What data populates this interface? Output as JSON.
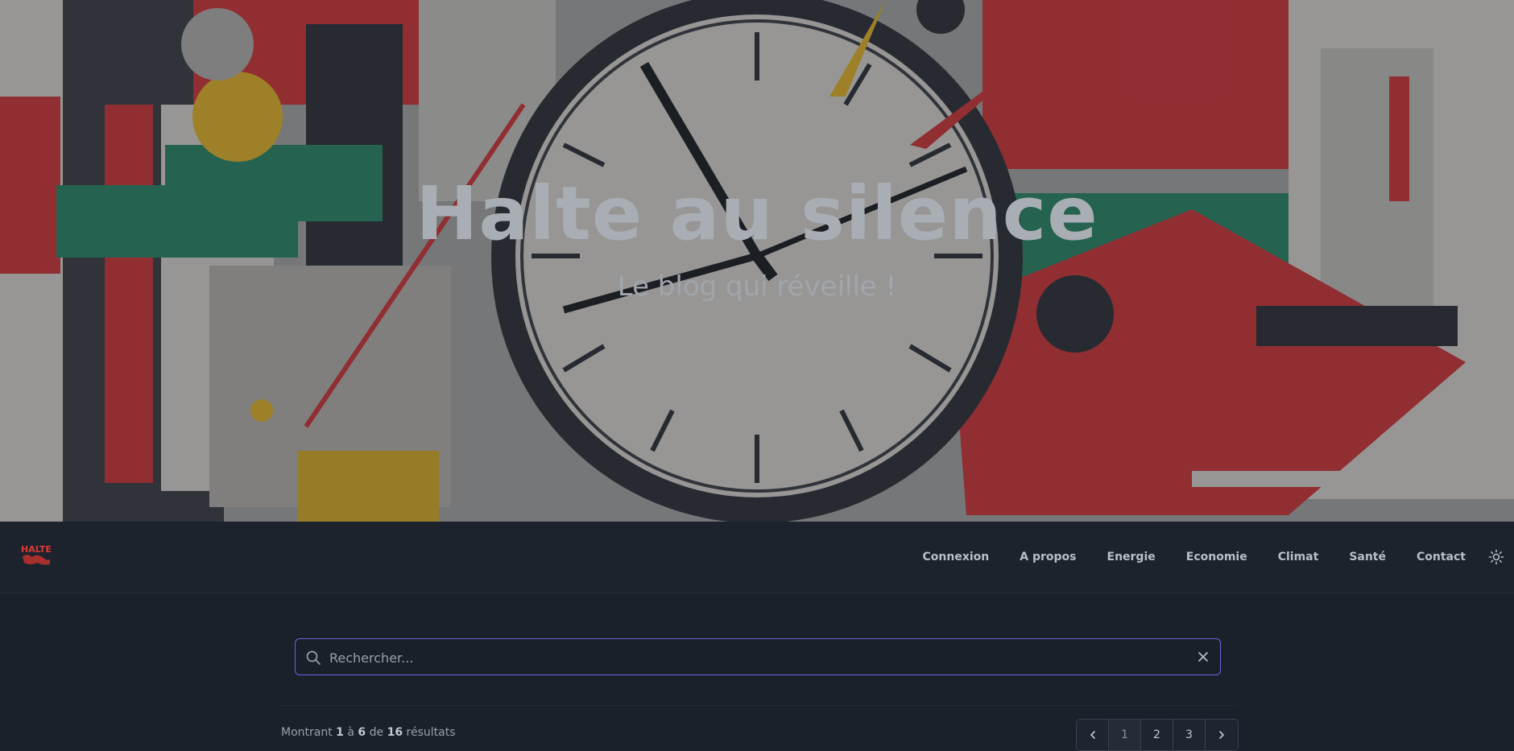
{
  "hero": {
    "title": "Halte au silence",
    "subtitle": "Le blog qui réveille !"
  },
  "logo": {
    "text": "HALTE",
    "color": "#d93a36"
  },
  "nav": {
    "items": [
      {
        "label": "Connexion"
      },
      {
        "label": "A propos"
      },
      {
        "label": "Energie"
      },
      {
        "label": "Economie"
      },
      {
        "label": "Climat"
      },
      {
        "label": "Santé"
      },
      {
        "label": "Contact"
      }
    ],
    "theme_icon": "sun-icon"
  },
  "search": {
    "placeholder": "Rechercher...",
    "value": "",
    "icon": "search-icon",
    "clear_icon": "close-icon",
    "accent_color": "#6a63d8"
  },
  "results": {
    "prefix": "Montrant",
    "from": "1",
    "sep1": "à",
    "to": "6",
    "sep2": "de",
    "total": "16",
    "suffix": "résultats"
  },
  "pagination": {
    "prev_icon": "chevron-left-icon",
    "next_icon": "chevron-right-icon",
    "pages": [
      "1",
      "2",
      "3"
    ],
    "current": "1"
  }
}
